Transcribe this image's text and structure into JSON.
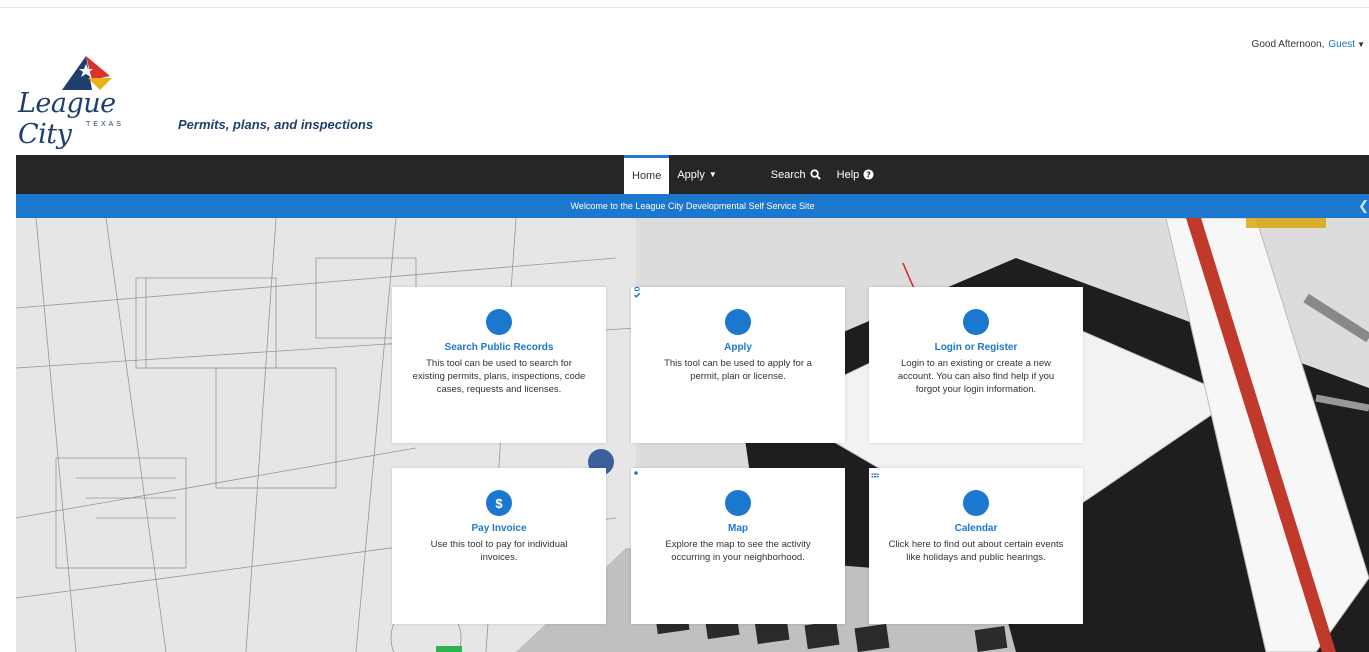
{
  "header": {
    "greeting": "Good Afternoon,",
    "user": "Guest",
    "logo_text": "League City",
    "logo_state": "TEXAS",
    "tagline": "Permits, plans, and inspections"
  },
  "nav": {
    "items": [
      {
        "label": "Home"
      },
      {
        "label": "Apply"
      },
      {
        "label": "Search"
      },
      {
        "label": "Help"
      }
    ]
  },
  "banner": {
    "text": "Welcome to the League City Developmental Self Service Site"
  },
  "cards": [
    {
      "title": "Search Public Records",
      "desc": "This tool can be used to search for existing permits, plans, inspections, code cases, requests and licenses.",
      "icon": "search-icon"
    },
    {
      "title": "Apply",
      "desc": "This tool can be used to apply for a permit, plan or license.",
      "icon": "clipboard-check-icon"
    },
    {
      "title": "Login or Register",
      "desc": "Login to an existing or create a new account. You can also find help if you forgot your login information.",
      "icon": "users-icon"
    },
    {
      "title": "Pay Invoice",
      "desc": "Use this tool to pay for individual invoices.",
      "icon": "dollar-icon"
    },
    {
      "title": "Map",
      "desc": "Explore the map to see the activity occurring in your neighborhood.",
      "icon": "map-marker-icon"
    },
    {
      "title": "Calendar",
      "desc": "Click here to find out about certain events like holidays and public hearings.",
      "icon": "calendar-icon"
    }
  ],
  "colors": {
    "brand_blue": "#1c78cf",
    "nav_dark": "#262626",
    "logo_navy": "#1f3e6c",
    "annotation_red": "#e02b2b"
  }
}
